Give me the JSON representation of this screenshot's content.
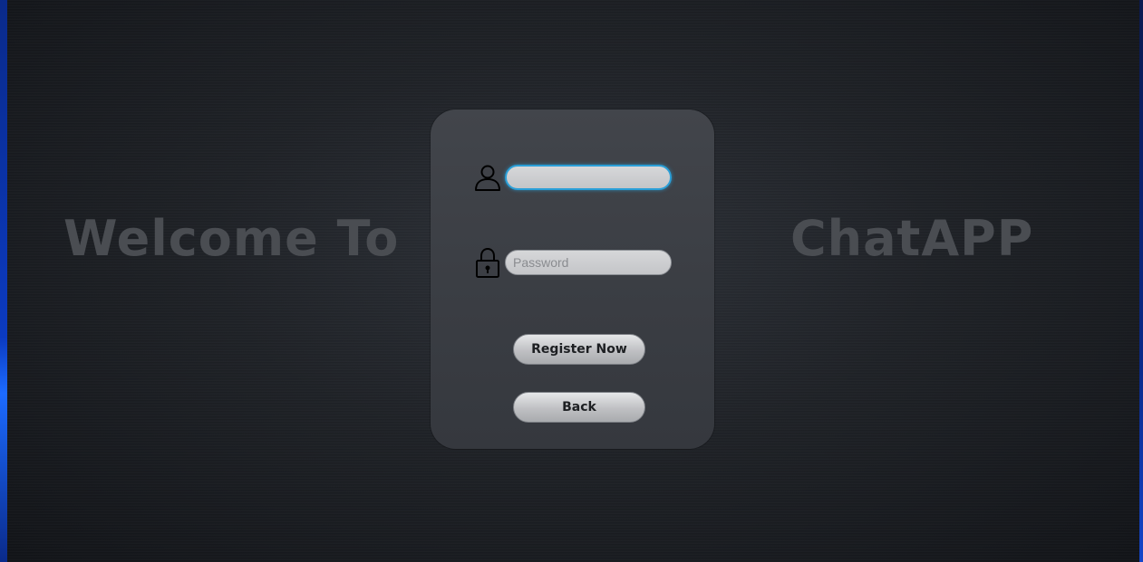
{
  "heading": {
    "left": "Welcome To",
    "right": "ChatAPP"
  },
  "login_form": {
    "username": {
      "value": "",
      "placeholder": "",
      "icon": "user-icon"
    },
    "password": {
      "value": "",
      "placeholder": "Password",
      "icon": "lock-icon"
    },
    "register_label": "Register Now",
    "back_label": "Back"
  },
  "colors": {
    "heading_text": "#4a4d52",
    "card_bg": "#3d4046",
    "focus_ring": "#2a9fd8",
    "desktop_accent": "#1c6bff"
  }
}
